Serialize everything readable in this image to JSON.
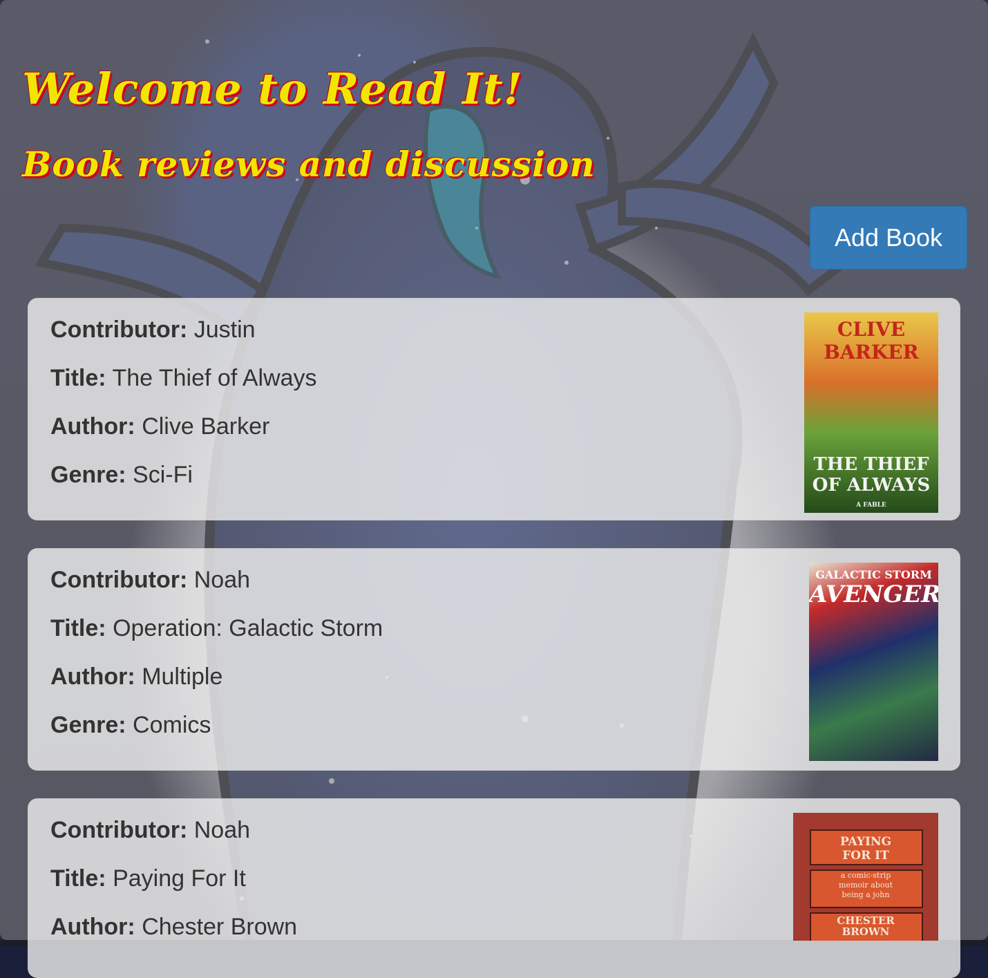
{
  "header": {
    "title": "Welcome to Read It!",
    "subtitle": "Book reviews and discussion",
    "title_color": "#f2e600",
    "title_shadow_color": "#d4001a"
  },
  "toolbar": {
    "add_book_label": "Add Book",
    "add_book_color": "#337ab7"
  },
  "labels": {
    "contributor": "Contributor:",
    "title": "Title:",
    "author": "Author:",
    "genre": "Genre:"
  },
  "books": [
    {
      "contributor": "Justin",
      "title": "The Thief of Always",
      "author": "Clive Barker",
      "genre": "Sci-Fi",
      "cover": {
        "top_text": "CLIVE BARKER",
        "bottom_text": "THE THIEF OF ALWAYS",
        "small_text": "A FABLE"
      }
    },
    {
      "contributor": "Noah",
      "title": "Operation: Galactic Storm",
      "author": "Multiple",
      "genre": "Comics",
      "cover": {
        "top_text": "GALACTIC STORM",
        "bottom_text": "AVENGERS"
      }
    },
    {
      "contributor": "Noah",
      "title": "Paying For It",
      "author": "Chester Brown",
      "genre": "",
      "cover": {
        "top_text": "PAYING FOR IT",
        "mid_text": "a comic-strip memoir about being a john",
        "bottom_text": "CHESTER BROWN"
      }
    }
  ]
}
